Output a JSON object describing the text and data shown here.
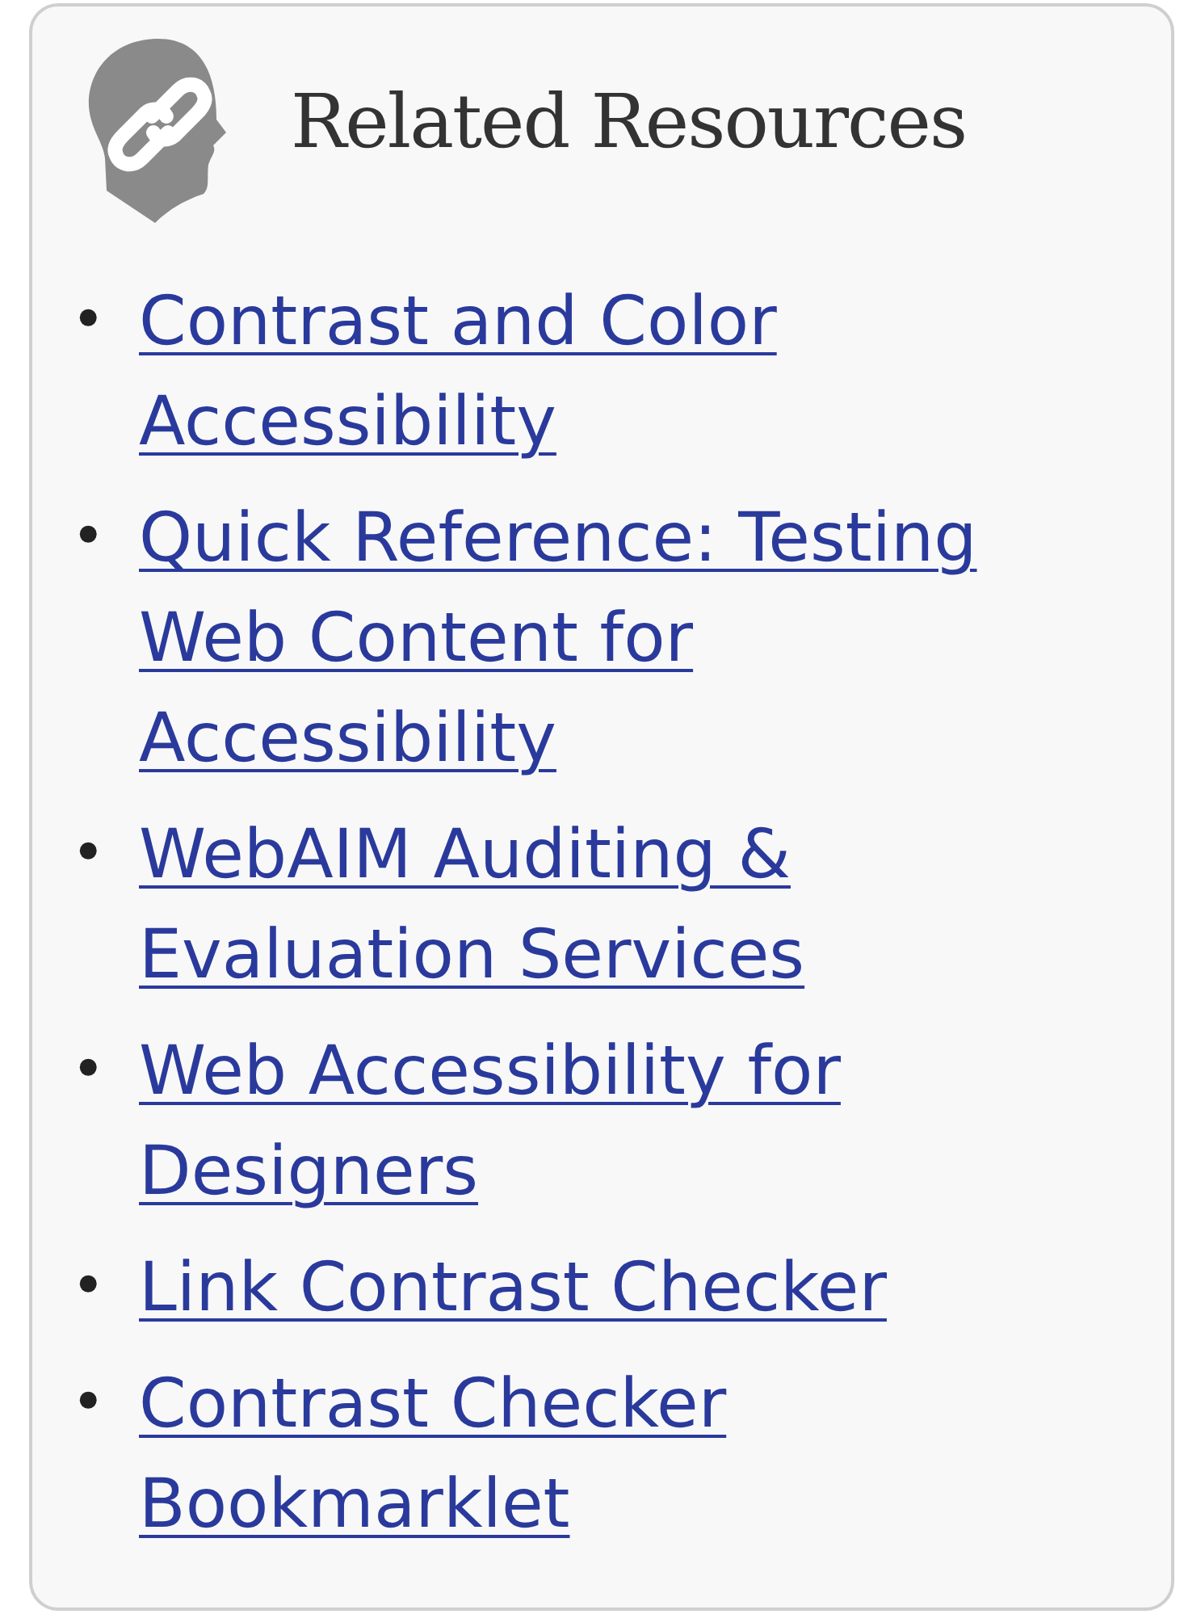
{
  "panel": {
    "title": "Related Resources",
    "links": [
      {
        "marker": "•",
        "text": "Contrast and Color Accessibility"
      },
      {
        "marker": "•",
        "text": "Quick Reference: Testing Web Content for Accessibility"
      },
      {
        "marker": "•",
        "text": "WebAIM Auditing & Evaluation Services"
      },
      {
        "marker": "•",
        "text": "Web Accessibility for Designers"
      },
      {
        "marker": "•",
        "text": "Link Contrast Checker"
      },
      {
        "marker": "•",
        "text": "Contrast Checker Bookmarklet"
      }
    ]
  }
}
